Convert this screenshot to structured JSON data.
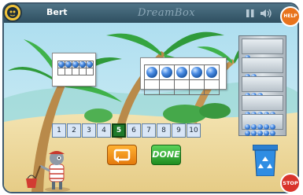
{
  "header": {
    "username": "Bert",
    "brand": "DreamBox"
  },
  "buttons": {
    "help_label": "HELP",
    "stop_label": "STOP",
    "done_label": "DONE"
  },
  "left_frame": {
    "cols": 5,
    "rows": 2,
    "filled": 5
  },
  "right_frame": {
    "cols": 5,
    "rows": 2,
    "filled": 5
  },
  "shelf": {
    "ball_counts": [
      1,
      2,
      3,
      5,
      10
    ]
  },
  "number_line": {
    "numbers": [
      "1",
      "2",
      "3",
      "4",
      "5",
      "6",
      "7",
      "8",
      "9",
      "10"
    ],
    "selected": "5"
  },
  "colors": {
    "selected_number": "#1f7a2a",
    "ball": "#2f6fd0",
    "done_button": "#2aa02b",
    "undo_button": "#f39a1e",
    "help_button": "#e8731c",
    "stop_button": "#d9342b"
  },
  "icons": [
    "avatar-icon",
    "pause-icon",
    "sound-icon",
    "undo-arrow-icon",
    "recycle-icon"
  ]
}
